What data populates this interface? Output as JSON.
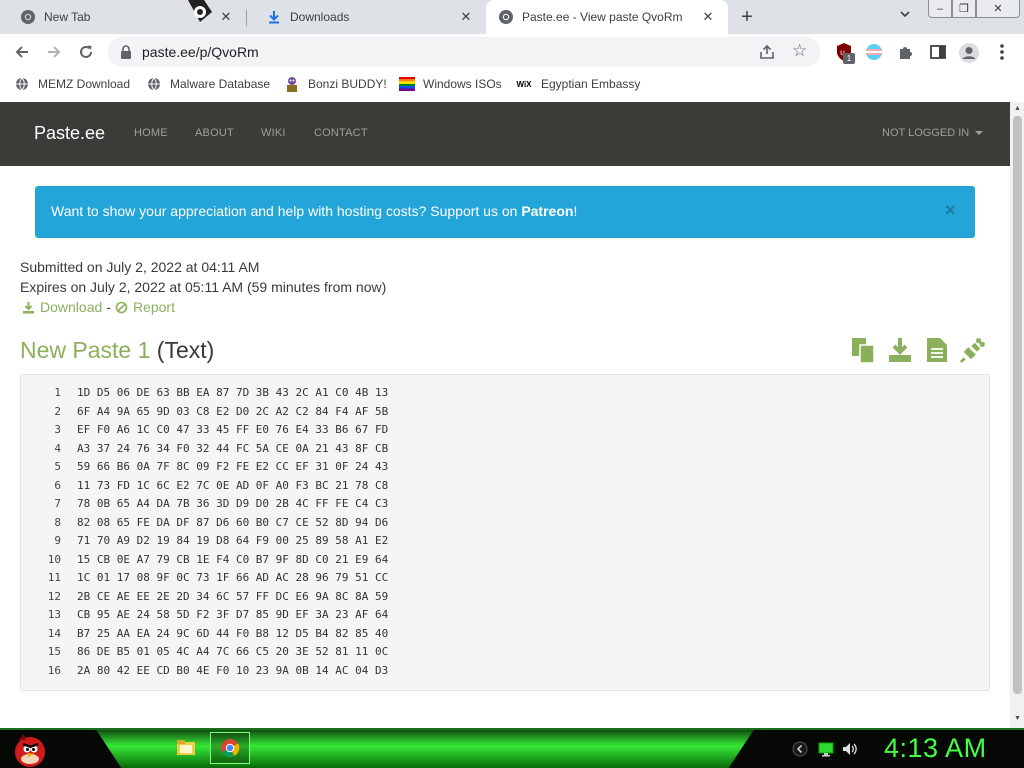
{
  "browser": {
    "tabs": [
      {
        "title": "New Tab",
        "icon": "chrome-logo-icon",
        "active": false
      },
      {
        "title": "Downloads",
        "icon": "download-icon",
        "active": false
      },
      {
        "title": "Paste.ee - View paste QvoRm",
        "icon": "chrome-logo-icon",
        "active": true
      }
    ],
    "new_tab_glyph": "+",
    "tab_search_glyph": "⌄",
    "close_glyph": "✕",
    "window_controls": {
      "minimize": "–",
      "maximize": "❐",
      "close": "✕"
    },
    "url": "paste.ee/p/QvoRm",
    "bookmarks": [
      {
        "label": "MEMZ Download",
        "icon": "globe-icon"
      },
      {
        "label": "Malware Database",
        "icon": "globe-icon"
      },
      {
        "label": "Bonzi BUDDY!",
        "icon": "bonzi-icon"
      },
      {
        "label": "Windows ISOs",
        "icon": "rainbow-flag-icon"
      },
      {
        "label": "Egyptian Embassy",
        "icon": "wix-icon"
      }
    ],
    "wix_text": "WiX",
    "extension_badge": "1"
  },
  "site": {
    "brand": "Paste.ee",
    "nav": [
      "HOME",
      "ABOUT",
      "WIKI",
      "CONTACT"
    ],
    "login": "NOT LOGGED IN",
    "alert": {
      "text": "Want to show your appreciation and help with hosting costs? Support us on ",
      "link": "Patreon",
      "suffix": "!",
      "close": "×"
    },
    "submitted": "Submitted on July 2, 2022 at 04:11 AM",
    "expires": "Expires on July 2, 2022 at 05:11 AM (59 minutes from now)",
    "download_link": "Download",
    "link_separator": "-",
    "report_link": "Report",
    "paste_title": "New Paste 1",
    "paste_type": "(Text)",
    "code_lines": [
      {
        "n": "1",
        "text": "1D D5 06 DE 63 BB EA 87 7D 3B 43 2C A1 C0 4B 13"
      },
      {
        "n": "2",
        "text": "6F A4 9A 65 9D 03 C8 E2 D0 2C A2 C2 84 F4 AF 5B"
      },
      {
        "n": "3",
        "text": "EF F0 A6 1C C0 47 33 45 FF E0 76 E4 33 B6 67 FD"
      },
      {
        "n": "4",
        "text": "A3 37 24 76 34 F0 32 44 FC 5A CE 0A 21 43 8F CB"
      },
      {
        "n": "5",
        "text": "59 66 B6 0A 7F 8C 09 F2 FE E2 CC EF 31 0F 24 43"
      },
      {
        "n": "6",
        "text": "11 73 FD 1C 6C E2 7C 0E AD 0F A0 F3 BC 21 78 C8"
      },
      {
        "n": "7",
        "text": "78 0B 65 A4 DA 7B 36 3D D9 D0 2B 4C FF FE C4 C3"
      },
      {
        "n": "8",
        "text": "82 08 65 FE DA DF 87 D6 60 B0 C7 CE 52 8D 94 D6"
      },
      {
        "n": "9",
        "text": "71 70 A9 D2 19 84 19 D8 64 F9 00 25 89 58 A1 E2"
      },
      {
        "n": "10",
        "text": "15 CB 0E A7 79 CB 1E F4 C0 B7 9F 8D C0 21 E9 64"
      },
      {
        "n": "11",
        "text": "1C 01 17 08 9F 0C 73 1F 66 AD AC 28 96 79 51 CC"
      },
      {
        "n": "12",
        "text": "2B CE AE EE 2E 2D 34 6C 57 FF DC E6 9A 8C 8A 59"
      },
      {
        "n": "13",
        "text": "CB 95 AE 24 58 5D F2 3F D7 85 9D EF 3A 23 AF 64"
      },
      {
        "n": "14",
        "text": "B7 25 AA EA 24 9C 6D 44 F0 B8 12 D5 B4 82 85 40"
      },
      {
        "n": "15",
        "text": "86 DE B5 01 05 4C A4 7C 66 C5 20 3E 52 81 11 0C"
      },
      {
        "n": "16",
        "text": "2A 80 42 EE CD B0 4E F0 10 23 9A 0B 14 AC 04 D3"
      }
    ]
  },
  "taskbar": {
    "clock": "4:13 AM"
  },
  "colors": {
    "site_nav_bg": "#3b3b38",
    "alert_bg": "#23a5d9",
    "accent_green": "#8bb05c",
    "taskbar_green": "#36e836",
    "clock_green": "#45ff45"
  }
}
